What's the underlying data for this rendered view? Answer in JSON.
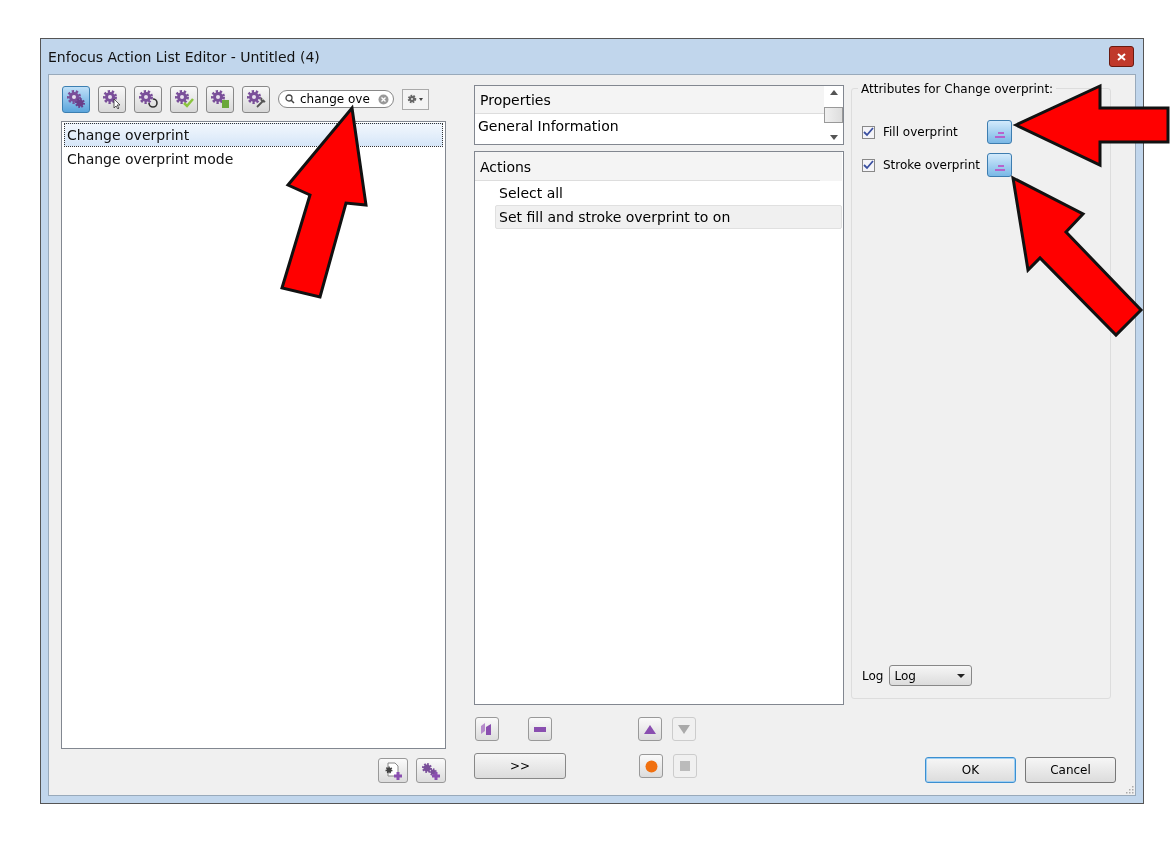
{
  "window": {
    "title": "Enfocus Action List Editor - Untitled (4)"
  },
  "tool_buttons": [
    {
      "kind": "gear",
      "selected": true
    },
    {
      "kind": "cursor",
      "selected": false
    },
    {
      "kind": "cycle",
      "selected": false
    },
    {
      "kind": "check",
      "selected": false
    },
    {
      "kind": "info",
      "selected": false
    },
    {
      "kind": "wrench",
      "selected": false
    }
  ],
  "search": {
    "value": "change ove"
  },
  "results": [
    {
      "label": "Change overprint",
      "selected": true
    },
    {
      "label": "Change overprint mode",
      "selected": false
    }
  ],
  "properties": {
    "header": "Properties",
    "items": [
      "General Information"
    ]
  },
  "actions": {
    "header": "Actions",
    "items": [
      {
        "label": "Select all",
        "selected": false
      },
      {
        "label": "Set fill and stroke overprint to on",
        "selected": true
      }
    ]
  },
  "action_controls": [
    {
      "kind": "duplicate",
      "disabled": false
    },
    {
      "kind": "remove",
      "disabled": false
    },
    {
      "kind": "up",
      "disabled": false
    },
    {
      "kind": "down",
      "disabled": true
    }
  ],
  "transfer_button": {
    "label": ">>"
  },
  "record_controls": [
    {
      "kind": "record",
      "disabled": false
    },
    {
      "kind": "stop",
      "disabled": true
    }
  ],
  "attributes": {
    "title": "Attributes for Change overprint:",
    "items": [
      {
        "label": "Fill overprint",
        "checked": true
      },
      {
        "label": "Stroke overprint",
        "checked": true
      }
    ],
    "log_label": "Log",
    "log_value": "Log"
  },
  "buttons": [
    {
      "label": "OK",
      "default": true
    },
    {
      "label": "Cancel",
      "default": false
    }
  ]
}
